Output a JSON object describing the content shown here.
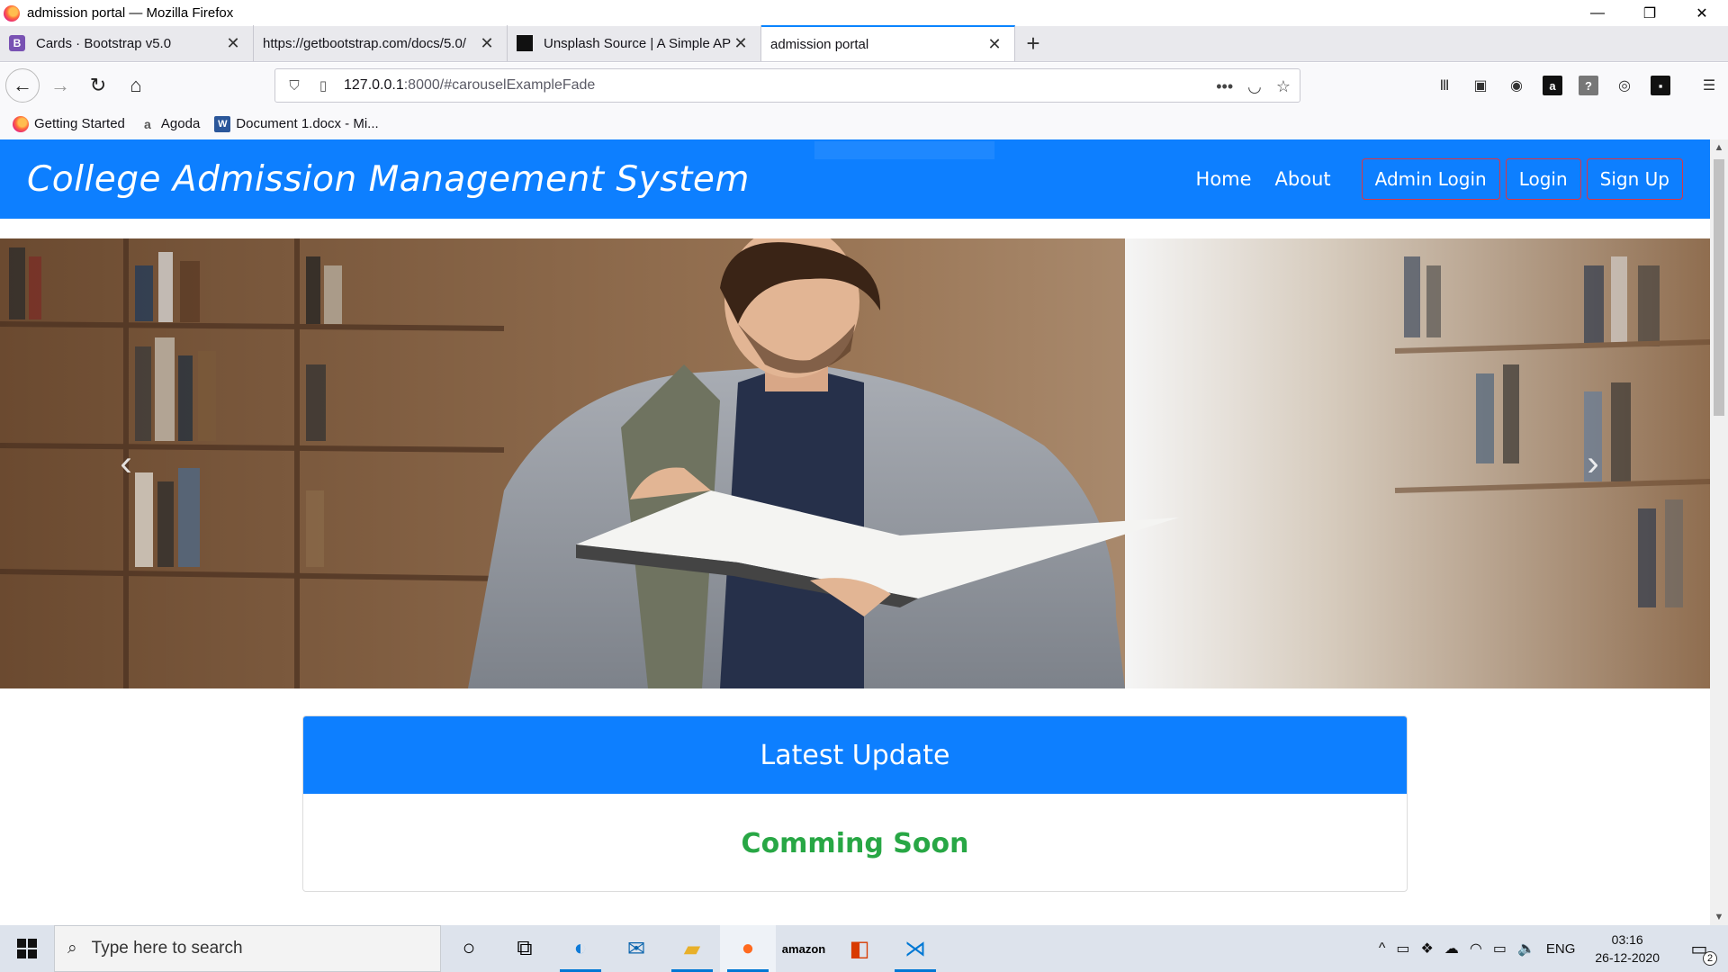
{
  "window": {
    "title": "admission portal — Mozilla Firefox",
    "controls": {
      "minimize": "—",
      "restore": "❐",
      "close": "✕"
    }
  },
  "tabs": [
    {
      "label": "Cards · Bootstrap v5.0",
      "icon": "bootstrap-icon",
      "icon_text": "B",
      "icon_color": "#7952b3"
    },
    {
      "label": "https://getbootstrap.com/docs/5.0/",
      "icon": "none"
    },
    {
      "label": "Unsplash Source | A Simple API",
      "icon": "unsplash-icon"
    },
    {
      "label": "admission portal",
      "icon": "none",
      "active": true
    }
  ],
  "newtab_label": "+",
  "urlbar": {
    "host": "127.0.0.1",
    "path": ":8000/#carouselExampleFade",
    "actions": [
      "•••",
      "pocket-icon",
      "star-icon"
    ]
  },
  "bookmarks": [
    {
      "label": "Getting Started",
      "icon": "firefox-icon"
    },
    {
      "label": "Agoda",
      "icon": "agoda-icon"
    },
    {
      "label": "Document 1.docx - Mi...",
      "icon": "word-icon"
    }
  ],
  "site": {
    "brand": "College Admission Management System",
    "links": [
      "Home",
      "About"
    ],
    "buttons": [
      "Admin Login",
      "Login",
      "Sign Up"
    ],
    "primary_color": "#0d7fff",
    "button_border_color": "#dc3545"
  },
  "carousel": {
    "prev": "‹",
    "next": "›"
  },
  "card": {
    "header": "Latest Update",
    "body": "Comming Soon",
    "body_color": "#28a745"
  },
  "taskbar": {
    "search_placeholder": "Type here to search",
    "apps": [
      "cortana-icon",
      "task-view-icon",
      "edge-icon",
      "mail-icon",
      "file-explorer-icon",
      "firefox-icon",
      "amazon-icon",
      "office-icon",
      "vscode-icon"
    ],
    "language": "ENG",
    "time": "03:16",
    "date": "26-12-2020",
    "notification_count": "2"
  }
}
